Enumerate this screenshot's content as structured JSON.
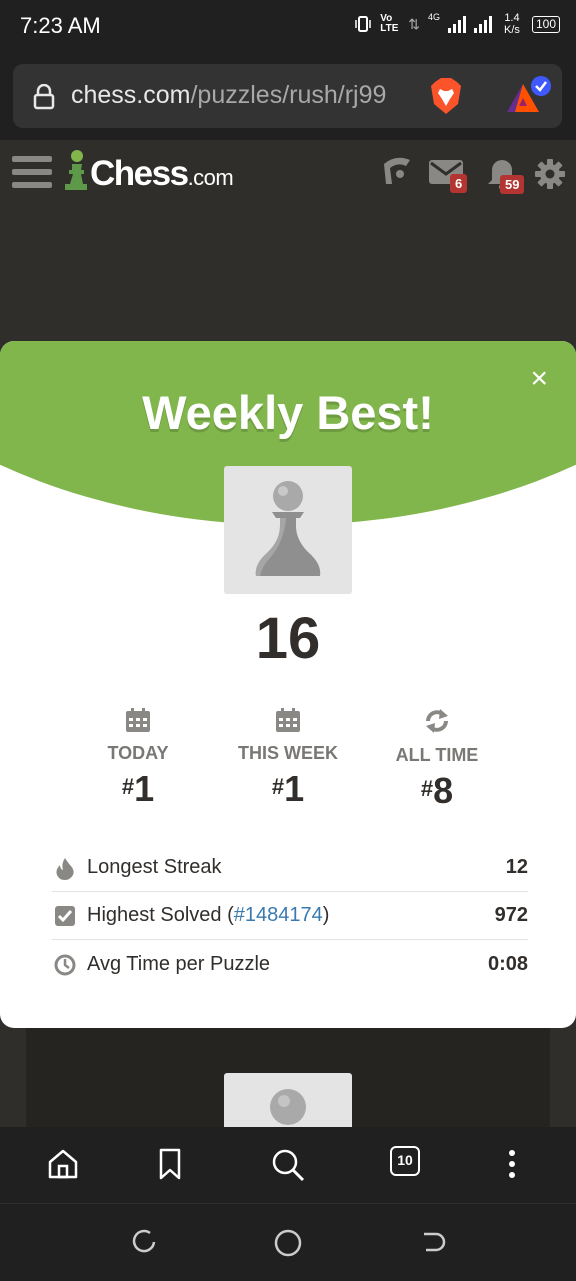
{
  "status_bar": {
    "time": "7:23 AM",
    "volte": "Vo LTE",
    "network": "4G",
    "speed": "1.4 K/s",
    "battery": "100"
  },
  "browser": {
    "url_host": "chess.com",
    "url_path": "/puzzles/rush/rj99",
    "tab_count": "10"
  },
  "site_header": {
    "logo_main": "Chess",
    "logo_suffix": ".com",
    "messages_badge": "6",
    "notifications_badge": "59"
  },
  "modal": {
    "title": "Weekly Best!",
    "close_label": "×",
    "score": "16",
    "stats": [
      {
        "label": "TODAY",
        "hash": "#",
        "rank": "1",
        "icon": "calendar-icon"
      },
      {
        "label": "THIS WEEK",
        "hash": "#",
        "rank": "1",
        "icon": "calendar-icon"
      },
      {
        "label": "ALL TIME",
        "hash": "#",
        "rank": "8",
        "icon": "refresh-icon"
      }
    ],
    "rows": [
      {
        "label": "Longest Streak",
        "value": "12",
        "icon": "flame-icon"
      },
      {
        "label": "Highest Solved (",
        "link": "#1484174",
        "label_end": ")",
        "value": "972",
        "icon": "checkbox-icon"
      },
      {
        "label": "Avg Time per Puzzle",
        "value": "0:08",
        "icon": "clock-icon"
      }
    ]
  },
  "colors": {
    "chess_green": "#81b64c",
    "header_bg": "#302e2b",
    "badge_red": "#b33430",
    "link_blue": "#3a7ab0"
  }
}
